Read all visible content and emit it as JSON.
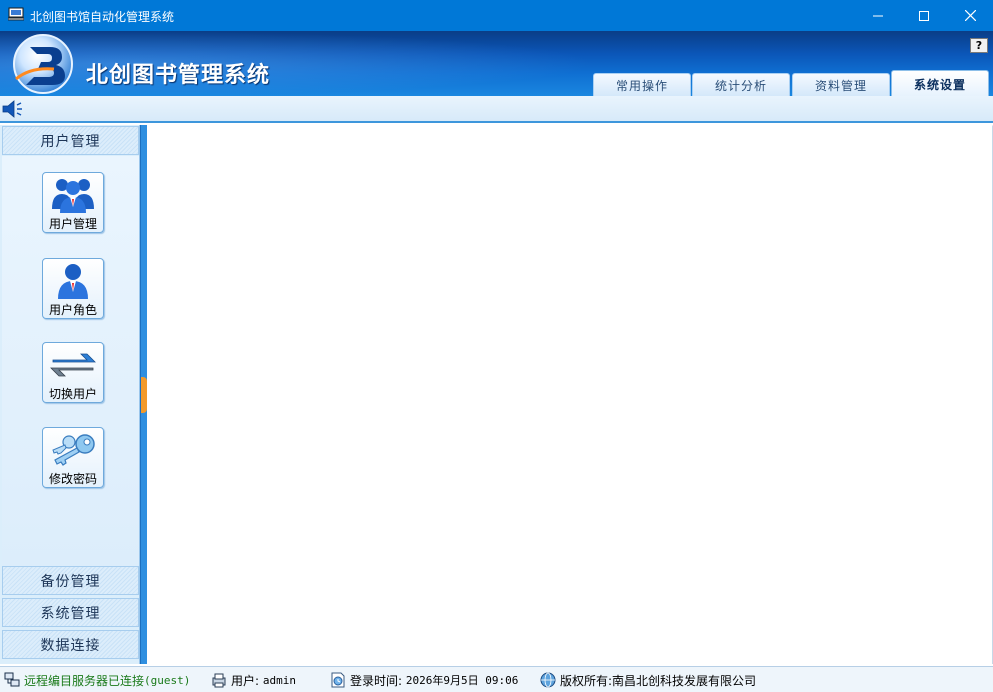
{
  "window": {
    "title": "北创图书馆自动化管理系统",
    "controls": {
      "minimize": "minimize-icon",
      "maximize": "maximize-icon",
      "close": "close-icon"
    }
  },
  "header": {
    "brand": "北创图书管理系统",
    "help_label": "?",
    "tabs": [
      {
        "label": "常用操作",
        "active": false
      },
      {
        "label": "统计分析",
        "active": false
      },
      {
        "label": "资料管理",
        "active": false
      },
      {
        "label": "系统设置",
        "active": true
      }
    ]
  },
  "sidebar": {
    "groups": [
      {
        "label": "用户管理",
        "expanded": true
      },
      {
        "label": "备份管理",
        "expanded": false
      },
      {
        "label": "系统管理",
        "expanded": false
      },
      {
        "label": "数据连接",
        "expanded": false
      }
    ],
    "tools": [
      {
        "label": "用户管理",
        "icon": "users-icon"
      },
      {
        "label": "用户角色",
        "icon": "user-role-icon"
      },
      {
        "label": "切换用户",
        "icon": "switch-arrows-icon"
      },
      {
        "label": "修改密码",
        "icon": "keys-icon"
      }
    ]
  },
  "status": {
    "connection_prefix": "远程编目服务器已连接",
    "connection_suffix": "(guest)",
    "user_label": "用户:",
    "user_value": "admin",
    "login_label": "登录时间:",
    "login_value": "2026年9月5日 09:06",
    "copyright_label": "版权所有:",
    "copyright_value": "南昌北创科技发展有限公司"
  },
  "colors": {
    "titlebar": "#0078d7",
    "banner": "#0b56b8",
    "splitter": "#2f8fe0",
    "grip": "#f39a2a",
    "status_green": "#1a7a1a"
  }
}
